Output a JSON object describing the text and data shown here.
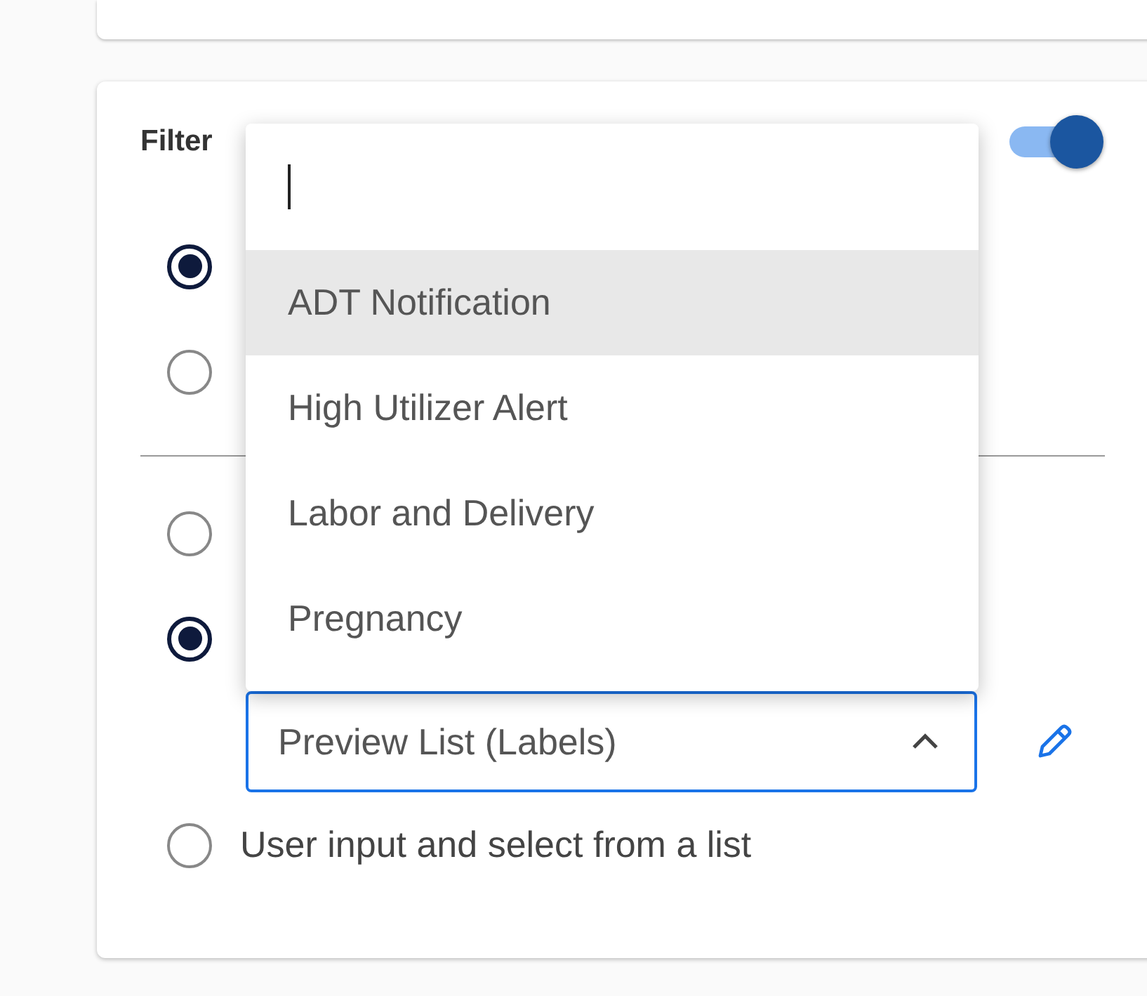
{
  "filter_card": {
    "title": "Filter",
    "enabled": true,
    "groups": [
      {
        "options": [
          {
            "selected": true
          },
          {
            "selected": false
          }
        ]
      },
      {
        "options": [
          {
            "selected": false
          },
          {
            "selected": true,
            "field": {
              "value": "Preview List (Labels)",
              "open": true
            }
          },
          {
            "selected": false,
            "label": "User input and select from a list"
          }
        ]
      }
    ],
    "dropdown": {
      "items": [
        {
          "label": "ADT Notification",
          "highlighted": true
        },
        {
          "label": "High Utilizer Alert",
          "highlighted": false
        },
        {
          "label": "Labor and Delivery",
          "highlighted": false
        },
        {
          "label": "Pregnancy",
          "highlighted": false
        }
      ]
    }
  }
}
